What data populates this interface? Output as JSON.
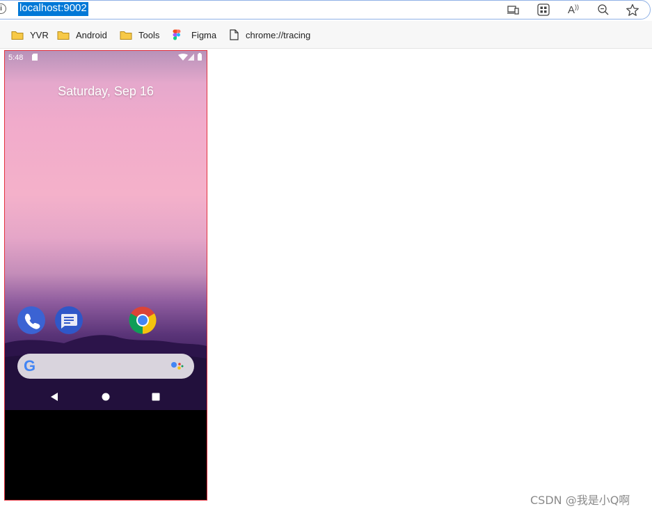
{
  "browser": {
    "url": "localhost:9002",
    "info_icon": "info-icon",
    "toolbar_icons": [
      "devices-icon",
      "apps-icon",
      "read-aloud-icon",
      "zoom-out-icon",
      "favorite-star-icon"
    ],
    "read_aloud_glyph": "A"
  },
  "bookmarks": [
    {
      "label": "YVR",
      "icon": "folder-icon"
    },
    {
      "label": "Android",
      "icon": "folder-icon"
    },
    {
      "label": "Tools",
      "icon": "folder-icon"
    },
    {
      "label": "Figma",
      "icon": "figma-icon"
    },
    {
      "label": "chrome://tracing",
      "icon": "page-icon"
    }
  ],
  "phone": {
    "status_time": "5:48",
    "date": "Saturday, Sep 16",
    "apps": [
      "phone-app-icon",
      "messages-app-icon",
      "chrome-app-icon"
    ],
    "search_logo": "G",
    "nav_buttons": [
      "back-button",
      "home-button",
      "recents-button"
    ],
    "colors": {
      "frame_border": "#e3303c",
      "search_bar": "#d9d4dd",
      "phone_app": "#3b63d3",
      "messages_app": "#2f57c8"
    }
  },
  "watermark": "CSDN @我是小Q啊",
  "colors": {
    "url_highlight": "#0078d7",
    "address_border": "#8fb1e6",
    "folder": "#f7c948"
  }
}
